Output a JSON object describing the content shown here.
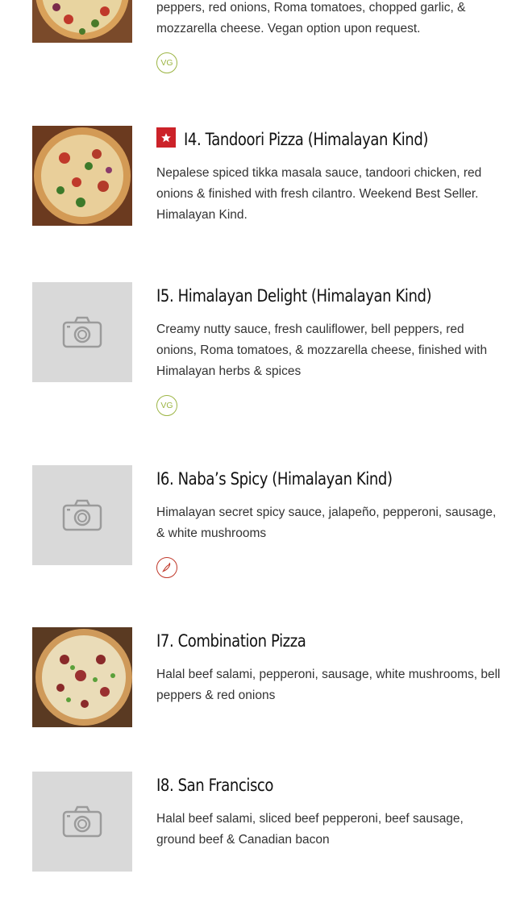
{
  "items": [
    {
      "id": "13",
      "description": "peppers, red onions, Roma tomatoes, chopped garlic, & mozzarella cheese. Vegan option upon request.",
      "badge": "VG",
      "image": "pizza-photo"
    },
    {
      "id": "14",
      "name": "I4. Tandoori Pizza (Himalayan Kind)",
      "description": "Nepalese spiced tikka masala sauce, tandoori chicken, red onions & finished with fresh cilantro. Weekend Best Seller. Himalayan Kind.",
      "highlight_icon": "star-icon",
      "image": "pizza-photo"
    },
    {
      "id": "15",
      "name": "I5. Himalayan Delight (Himalayan Kind)",
      "description": "Creamy nutty sauce, fresh cauliflower, bell peppers, red onions, Roma tomatoes, & mozzarella cheese, finished with Himalayan herbs & spices",
      "badge": "VG",
      "image": "camera-placeholder"
    },
    {
      "id": "16",
      "name": "I6. Naba’s Spicy (Himalayan Kind)",
      "description": "Himalayan secret spicy sauce, jalapeño, pepperoni, sausage, & white mushrooms",
      "badge_icon": "chili-icon",
      "image": "camera-placeholder"
    },
    {
      "id": "17",
      "name": "I7. Combination Pizza",
      "description": "Halal beef salami, pepperoni, sausage, white mushrooms, bell peppers & red onions",
      "image": "pizza-photo"
    },
    {
      "id": "18",
      "name": "I8. San Francisco",
      "description": "Halal beef salami, sliced beef pepperoni, beef sausage, ground beef & Canadian bacon",
      "image": "camera-placeholder"
    }
  ],
  "colors": {
    "vegan": "#9cb544",
    "spicy": "#c0392b",
    "highlight": "#cc2229",
    "placeholder_bg": "#d9d9d9"
  }
}
